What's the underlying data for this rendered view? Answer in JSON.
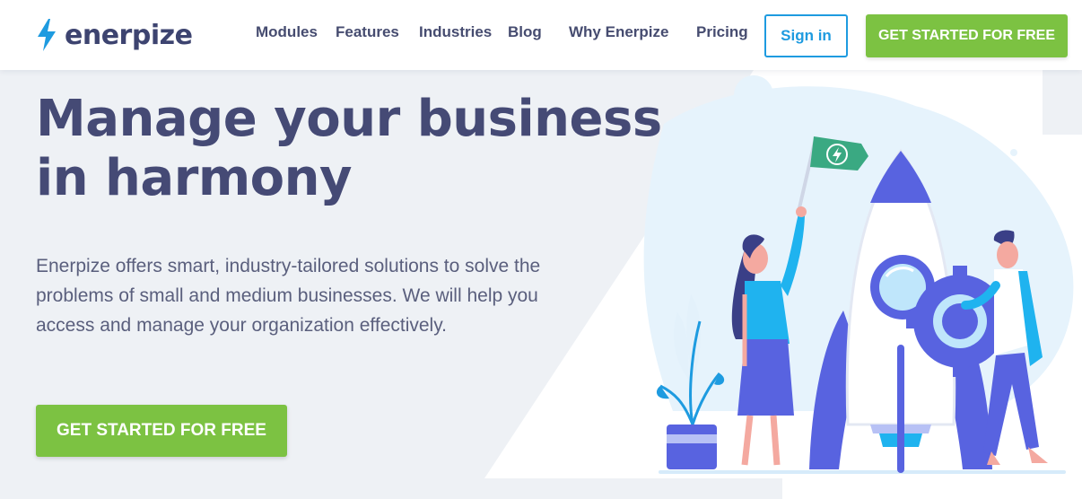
{
  "brand": {
    "name": "enerpize",
    "colors": {
      "primary_text": "#454a75",
      "accent_blue": "#1e9be0",
      "cta_green": "#7cc242",
      "illustration_purple": "#5863e0"
    }
  },
  "nav": {
    "items": [
      {
        "label": "Modules"
      },
      {
        "label": "Features"
      },
      {
        "label": "Industries"
      },
      {
        "label": "Blog"
      },
      {
        "label": "Why Enerpize"
      },
      {
        "label": "Pricing"
      }
    ],
    "signin_label": "Sign in",
    "cta_label": "GET STARTED FOR FREE"
  },
  "hero": {
    "title_line1": "Manage your business",
    "title_line2": "in harmony",
    "description": "Enerpize offers smart, industry-tailored solutions to solve the problems of small and medium businesses. We will help you access and manage your organization effectively.",
    "cta_label": "GET STARTED FOR FREE"
  },
  "illustration": {
    "icons": [
      "rocket-icon",
      "flag-icon",
      "lightning-icon",
      "gear-icon",
      "plant-icon"
    ]
  }
}
